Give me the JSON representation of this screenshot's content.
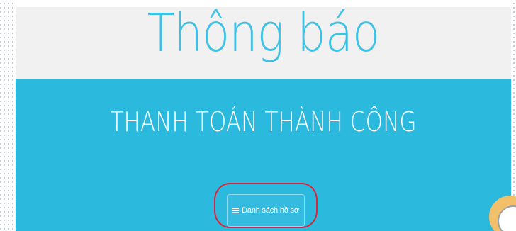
{
  "notice": {
    "title": "Thông báo",
    "message": "THANH TOÁN THÀNH CÔNG",
    "list_button": {
      "label": "Danh sách hồ sơ",
      "icon": "list-icon"
    }
  },
  "colors": {
    "title_color": "#3dc1e6",
    "body_background": "#2cb9de",
    "header_background": "#f1f1f1",
    "highlight": "#d9263a"
  }
}
